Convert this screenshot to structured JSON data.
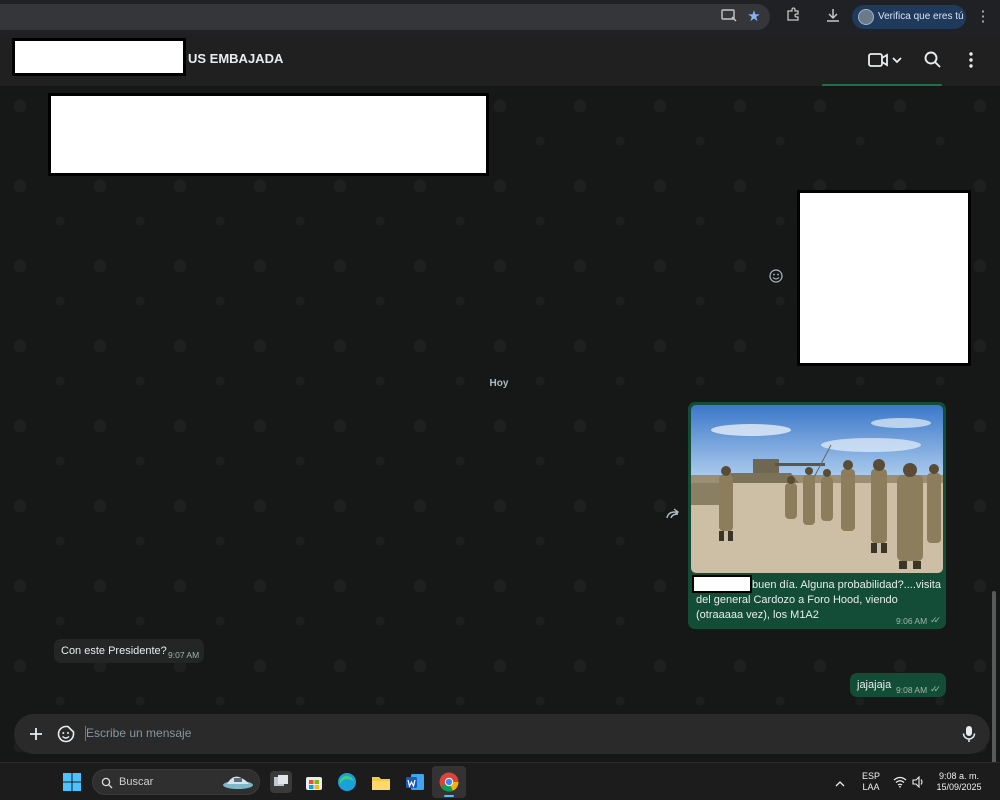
{
  "browser": {
    "profile_label": "Verifica que eres tú"
  },
  "chat": {
    "contact_name": "US EMBAJADA"
  },
  "date_divider": "Hoy",
  "messages": {
    "outgoing_photo": {
      "caption": "buen día. Alguna probabilidad?....visita del general Cardozo a Foro Hood, viendo (otraaaaa vez), los M1A2",
      "time": "9:06 AM"
    },
    "incoming": {
      "text": "Con este Presidente?",
      "time": "9:07 AM"
    },
    "outgoing_text": {
      "text": "jajajaja",
      "time": "9:08 AM"
    }
  },
  "composer": {
    "placeholder": "Escribe un mensaje"
  },
  "taskbar": {
    "search_label": "Buscar",
    "language": "ESP",
    "layout": "LAA",
    "time": "9:08 a. m.",
    "date": "15/09/2025"
  },
  "colors": {
    "outgoing_bubble": "#144d37",
    "incoming_bubble": "#242626",
    "accent": "#00a884"
  }
}
